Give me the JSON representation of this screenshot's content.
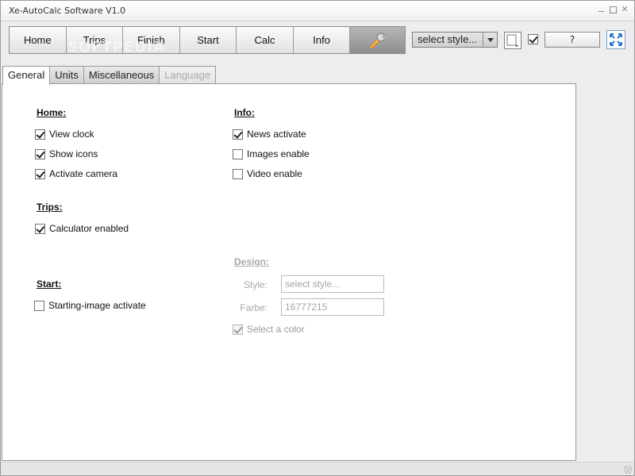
{
  "window": {
    "title": "Xe-AutoCalc Software V1.0"
  },
  "toolbar": {
    "nav": [
      "Home",
      "Trips",
      "Finish",
      "Start",
      "Calc",
      "Info"
    ],
    "tools_icon": "wrench-icon",
    "watermark": "SOFTPEDIA",
    "style_select": "select style...",
    "help_label": "?"
  },
  "tabs": [
    {
      "label": "General",
      "state": "active"
    },
    {
      "label": "Units",
      "state": "normal"
    },
    {
      "label": "Miscellaneous",
      "state": "normal"
    },
    {
      "label": "Language",
      "state": "disabled"
    }
  ],
  "general": {
    "home": {
      "title": "Home:",
      "options": [
        {
          "label": "View clock",
          "checked": true
        },
        {
          "label": "Show icons",
          "checked": true
        },
        {
          "label": "Activate camera",
          "checked": true
        }
      ]
    },
    "trips": {
      "title": "Trips:",
      "options": [
        {
          "label": "Calculator enabled",
          "checked": true
        }
      ]
    },
    "start": {
      "title": "Start:",
      "options": [
        {
          "label": "Starting-image activate",
          "checked": false
        }
      ]
    },
    "info": {
      "title": "Info:",
      "options": [
        {
          "label": "News activate",
          "checked": true
        },
        {
          "label": "Images enable",
          "checked": false
        },
        {
          "label": "Video enable",
          "checked": false
        }
      ]
    },
    "design": {
      "title": "Design:",
      "style_label": "Style:",
      "style_value": "select style...",
      "farbe_label": "Farbe:",
      "farbe_value": "16777215",
      "select_color": {
        "label": "Select a color",
        "checked": true
      }
    }
  },
  "colors": {
    "accent": "#f0a020",
    "fullscreen": "#2a72c8",
    "panel_bg": "#ffffff"
  }
}
